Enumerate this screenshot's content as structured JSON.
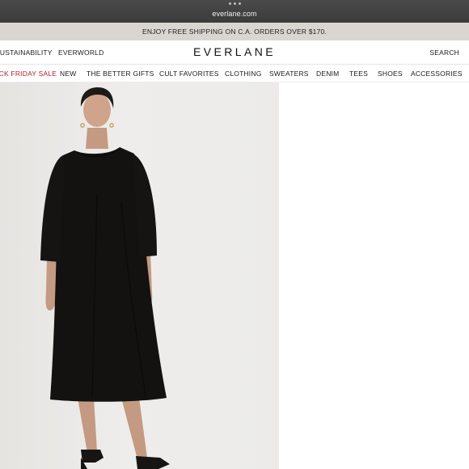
{
  "browser": {
    "url": "everlane.com"
  },
  "promo": {
    "text": "ENJOY FREE SHIPPING ON C.A. ORDERS OVER $170."
  },
  "header": {
    "left_links": [
      "SUSTAINABILITY",
      "EVERWORLD"
    ],
    "logo": "EVERLANE",
    "search_label": "SEARCH"
  },
  "nav": {
    "items": [
      "BLACK FRIDAY SALE",
      "NEW",
      "THE BETTER GIFTS",
      "CULT FAVORITES",
      "CLOTHING",
      "SWEATERS",
      "DENIM",
      "TEES",
      "SHOES",
      "ACCESSORIES"
    ]
  },
  "colors": {
    "promo_bg": "#d9d6d1",
    "sale_red": "#b21f2d",
    "dress": "#141210",
    "hero_bg": "#eae8e5"
  }
}
